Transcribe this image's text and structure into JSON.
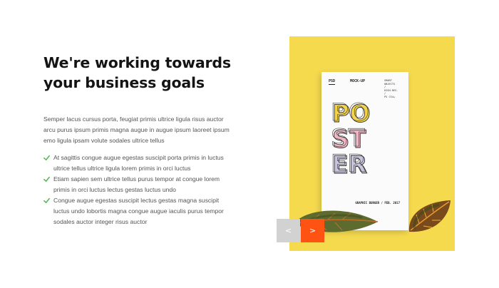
{
  "section": {
    "heading": "We're working towards your business goals",
    "intro": "Semper lacus cursus porta, feugiat primis ultrice ligula risus auctor arcu purus ipsum primis magna augue in augue ipsum laoreet ipsum emo ligula ipsam volute sodales ultrice tellus",
    "checklist": [
      "At sagittis congue augue egestas suscipit porta primis in luctus ultrice tellus ultrice ligula lorem primis in orci luctus",
      "Etiam sapien sem ultrice tellus purus tempor at congue lorem primis in orci luctus lectus gestas luctus undo",
      "Congue augue egestas suscipit lectus gestas magna suscipit luctus undo lobortis magna congue augue iaculis purus tempor sodales auctor integer risus auctor"
    ],
    "check_icon": "check-icon",
    "check_color": "#5cb85c"
  },
  "image": {
    "poster_label_left": "PSD",
    "poster_label_mid": "MOCK-UP",
    "poster_specs": "SMART\nOBJECTS\n/\nHIGH-RES.\n/\nPS CS4+",
    "poster_word_lines": [
      "PO",
      "ST",
      "ER"
    ],
    "poster_footer": "GRAPHIC BURGER / FEB. 2017",
    "background_color": "#f5da4e"
  },
  "slider": {
    "prev_label": "<",
    "next_label": ">",
    "accent": "#ff5314"
  }
}
